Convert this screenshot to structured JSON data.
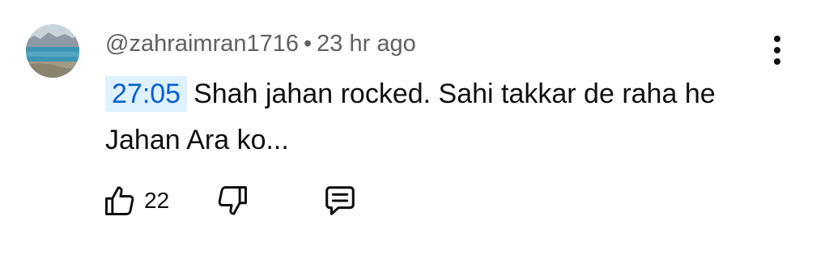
{
  "comment": {
    "author": "@zahraimran1716",
    "separator": "•",
    "time": "23 hr ago",
    "timestamp_link": "27:05",
    "text": "Shah jahan rocked. Sahi takkar de raha he Jahan Ara ko...",
    "like_count": "22"
  },
  "icons": {
    "avatar": "landscape-avatar",
    "menu": "more-vert-icon",
    "like": "thumbs-up-icon",
    "dislike": "thumbs-down-icon",
    "reply": "comment-reply-icon"
  },
  "colors": {
    "timestamp_bg": "#def1ff",
    "timestamp_text": "#065fd4",
    "meta_text": "#606060",
    "text": "#0f0f0f"
  }
}
